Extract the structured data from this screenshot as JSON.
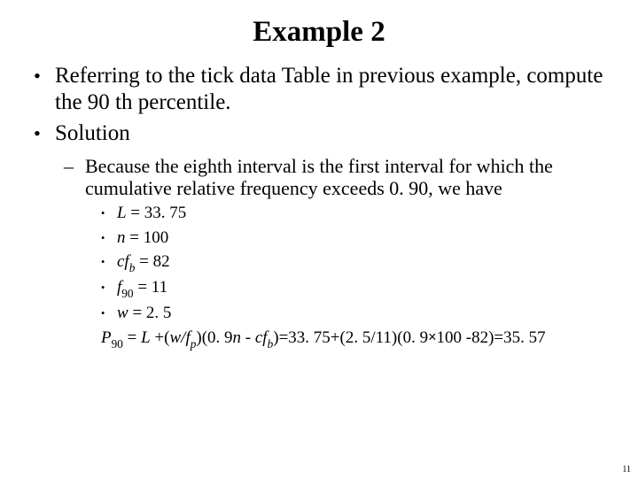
{
  "title": "Example 2",
  "bullets": {
    "b1": "Referring to the tick data Table in previous example, compute the 90 th percentile.",
    "b2": "Solution",
    "sub1": "Because the eighth interval is the first interval for which the cumulative relative frequency exceeds 0. 90, we have",
    "eq_L_pre": "L",
    "eq_L_post": " = 33. 75",
    "eq_n_pre": "n",
    "eq_n_post": " = 100",
    "eq_cf_pre": "cf",
    "eq_cf_sub": "b",
    "eq_cf_post": " = 82",
    "eq_f_pre": "f",
    "eq_f_sub": "90",
    "eq_f_post": " = 11",
    "eq_w_pre": "w",
    "eq_w_post": " = 2. 5",
    "formula_P": "P",
    "formula_Psub": "90",
    "formula_mid1": " = ",
    "formula_L2": "L",
    "formula_mid2": " +(",
    "formula_w": "w/f",
    "formula_fp_sub": "p",
    "formula_mid3": ")(0. 9",
    "formula_n2": "n",
    "formula_mid4": " - ",
    "formula_cf2": "cf",
    "formula_cf2_sub": "b",
    "formula_mid5": ")=33. 75+(2. 5/11)(0. 9",
    "formula_mult": "×",
    "formula_tail": "100 -82)=35. 57"
  },
  "pagenum": "11"
}
